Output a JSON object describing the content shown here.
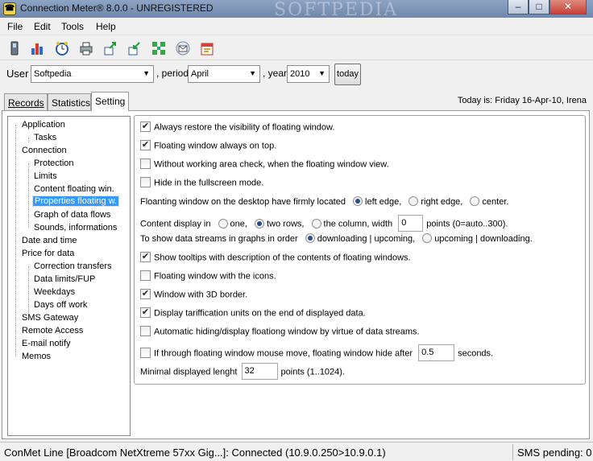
{
  "window": {
    "title": "Connection Meter® 8.0.0 - UNREGISTERED",
    "watermark": "SOFTPEDIA",
    "min": "–",
    "max": "□",
    "close": "✕",
    "close_color": "#c8413a"
  },
  "menu": [
    "File",
    "Edit",
    "Tools",
    "Help"
  ],
  "toolbar": [
    "phone-icon",
    "bar-chart-icon",
    "clock-icon",
    "print-icon",
    "export-icon",
    "import-icon",
    "grid-icon",
    "mail-icon",
    "calendar-icon"
  ],
  "filter": {
    "user_label": "User",
    "user_value": "Softpedia",
    "period_label": ", period",
    "period_value": "April",
    "year_label": ", year",
    "year_value": "2010",
    "today_button": "today"
  },
  "tabs": [
    "Records",
    "Statistics",
    "Setting"
  ],
  "today_text": "Today is: Friday 16-Apr-10, Irena",
  "tree": [
    "Application",
    "Tasks",
    "Connection",
    "Protection",
    "Limits",
    "Content floating win.",
    "Properties floating w.",
    "Graph of data flows",
    "Sounds, informations",
    "Date and time",
    "Price for data",
    "Correction transfers",
    "Data limits/FUP",
    "Weekdays",
    "Days off work",
    "SMS Gateway",
    "Remote Access",
    "E-mail notify",
    "Memos"
  ],
  "settings": {
    "always_restore": "Always restore the visibility of floating window.",
    "always_on_top": "Floating window always on top.",
    "without_working_area": "Without working area check, when the floating window view.",
    "hide_fullscreen": "Hide in the fullscreen mode.",
    "location_label": "Floanting window on the desktop have firmly located",
    "loc_left": "left edge,",
    "loc_right": "right edge,",
    "loc_center": "center.",
    "content_label": "Content display in",
    "content_one": "one,",
    "content_two": "two rows,",
    "content_column": "the column, width",
    "width_value": "0",
    "width_suffix": "points (0=auto..300).",
    "streams_label": "To show data streams in graphs in order",
    "streams_down_up": "downloading | upcoming,",
    "streams_up_down": "upcoming | downloading.",
    "show_tooltips": "Show tooltips with description of the contents of floating windows.",
    "with_icons": "Floating window with the icons.",
    "border_3d": "Window with 3D border.",
    "tariff_units": "Display tariffication units on the end of displayed data.",
    "auto_hide": "Automatic hiding/display floationg window by virtue of data streams.",
    "mouse_hide": "If through floating window mouse move, floating window hide after",
    "mouse_hide_value": "0.5",
    "mouse_hide_suffix": "seconds.",
    "min_length_label": "Minimal displayed lenght",
    "min_length_value": "32",
    "min_length_suffix": "points (1..1024)."
  },
  "status": {
    "connection": "ConMet Line [Broadcom NetXtreme 57xx Gig...]: Connected (10.9.0.250>10.9.0.1)",
    "sms": "SMS pending: 0"
  }
}
